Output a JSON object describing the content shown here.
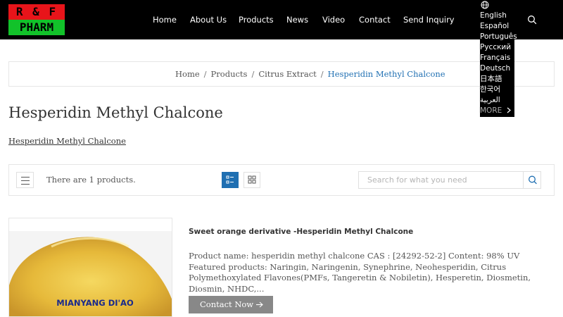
{
  "logo": {
    "line1": "R & F",
    "line2": "PHARM"
  },
  "nav": {
    "home": "Home",
    "about": "About Us",
    "products": "Products",
    "news": "News",
    "video": "Video",
    "contact": "Contact",
    "inquiry": "Send Inquiry"
  },
  "languages": [
    "English",
    "Español",
    "Português",
    "Pусский",
    "Français",
    "Deutsch",
    "日本語",
    "한국어",
    "العربية"
  ],
  "languages_more": "MORE",
  "breadcrumb": {
    "home": "Home",
    "products": "Products",
    "category": "Citrus Extract",
    "current": "Hesperidin Methyl Chalcone",
    "separator": "/"
  },
  "page_title": "Hesperidin Methyl Chalcone",
  "sub_link": "Hesperidin Methyl Chalcone",
  "toolbar": {
    "count_text": "There are 1 products.",
    "search_placeholder": "Search for what you need"
  },
  "product": {
    "image_text": "MIANYANG DI'AO",
    "name": "Sweet orange derivative -Hesperidin Methyl Chalcone",
    "description": "Product name: hesperidin methyl chalcone CAS : [24292-52-2] Content: 98% UV Featured products: Naringin, Naringenin, Synephrine, Neohesperidin, Citrus Polymethoxylated Flavones(PMFs, Tangeretin & Nobiletin), Hesperetin, Diosmetin, Diosmin, NHDC,...",
    "button_label": "Contact Now"
  },
  "colors": {
    "header_bg": "#000000",
    "accent": "#1f6fb2",
    "button_bg": "#888888",
    "logo_red": "#e8141a",
    "logo_green": "#12c22a"
  }
}
